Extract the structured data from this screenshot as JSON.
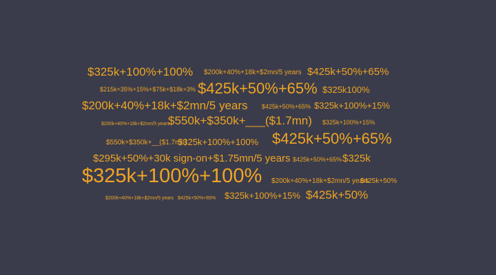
{
  "background_color": "#3a3c4b",
  "text_color": "#f0a524",
  "words": [
    "$325k+100%+100%",
    "$200k+40%+18k+$2mn/5 years",
    "$425k+50%+65%",
    "$215k+35%+15%+$75k+$18k+3%",
    "$425k+50%+65%",
    "$325k100%",
    "$200k+40%+18k+$2mn/5 years",
    "$425k+50%+65%",
    "$325k+100%+15%",
    "$200k+40%+18k+$2mn/5 years",
    "$550k+$350k+___($1.7mn)",
    "$325k+100%+15%",
    "$550k+$350k+__($1.7mn)",
    "$325k+100%+100%",
    "$425k+50%+65%",
    "$295k+50%+30k sign-on+$1.75mn/5 years",
    "$425k+50%+65%",
    "$325k",
    "$325k+100%+100%",
    "$200k+40%+18k+$2mn/5 years",
    "$425k+50%",
    "$200k+40%+18k+$2mn/5 years",
    "$425k+50%+65%",
    "$325k+100%+15%",
    "$425k+50%"
  ]
}
